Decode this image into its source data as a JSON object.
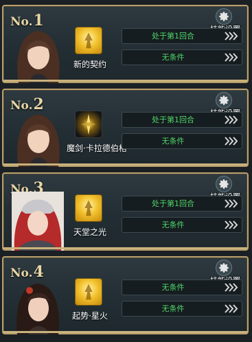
{
  "header": {
    "settings_label": "技能设置"
  },
  "cards": [
    {
      "no_prefix": "No.",
      "number": "1",
      "skill_name": "新的契约",
      "conditions": [
        "处于第1回合",
        "无条件"
      ]
    },
    {
      "no_prefix": "No.",
      "number": "2",
      "skill_name": "魔剑·卡拉德伯格",
      "conditions": [
        "处于第1回合",
        "无条件"
      ]
    },
    {
      "no_prefix": "No.",
      "number": "3",
      "skill_name": "天堂之光",
      "conditions": [
        "处于第1回合",
        "无条件"
      ]
    },
    {
      "no_prefix": "No.",
      "number": "4",
      "skill_name": "起势·星火",
      "conditions": [
        "无条件",
        "无条件"
      ]
    }
  ],
  "icons": {
    "settings": "gear-icon",
    "advance": "chevron-right-icon",
    "skill": "skill-icon"
  },
  "colors": {
    "accent_gold": "#b9a06e",
    "condition_text": "#4fd56a",
    "card_bg": "#243036"
  }
}
